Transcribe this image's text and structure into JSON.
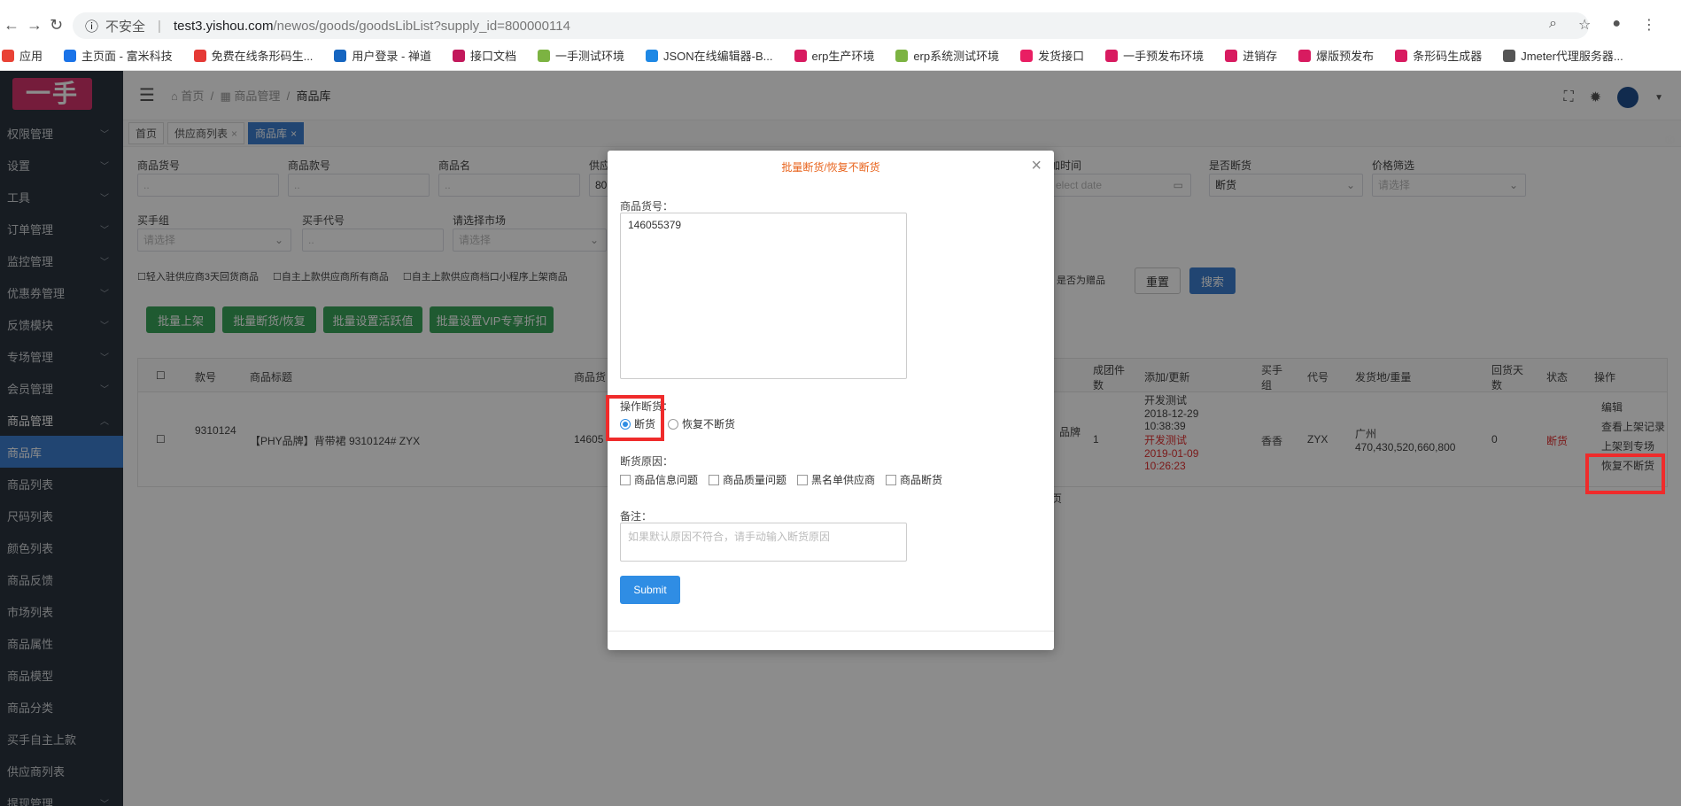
{
  "browser": {
    "insecure_label": "不安全",
    "url_host": "test3.yishou.com",
    "url_path": "/newos/goods/goodsLibList?supply_id=800000114"
  },
  "bookmarks": [
    {
      "label": "应用",
      "color": "#e94235"
    },
    {
      "label": "主页面 - 富米科技",
      "color": "#1a73e8"
    },
    {
      "label": "免费在线条形码生...",
      "color": "#e53935"
    },
    {
      "label": "用户登录 - 禅道",
      "color": "#1565c0"
    },
    {
      "label": "接口文档",
      "color": "#c2185b"
    },
    {
      "label": "一手测试环境",
      "color": "#7cb342"
    },
    {
      "label": "JSON在线编辑器-B...",
      "color": "#1e88e5"
    },
    {
      "label": "erp生产环境",
      "color": "#d81b60"
    },
    {
      "label": "erp系统测试环境",
      "color": "#7cb342"
    },
    {
      "label": "发货接口",
      "color": "#e91e63"
    },
    {
      "label": "一手预发布环境",
      "color": "#d81b60"
    },
    {
      "label": "进销存",
      "color": "#d81b60"
    },
    {
      "label": "爆版预发布",
      "color": "#d81b60"
    },
    {
      "label": "条形码生成器",
      "color": "#d81b60"
    },
    {
      "label": "Jmeter代理服务器...",
      "color": "#555555"
    }
  ],
  "sidebar": {
    "logo": "一手",
    "items": [
      {
        "label": "权限管理"
      },
      {
        "label": "设置"
      },
      {
        "label": "工具"
      },
      {
        "label": "订单管理"
      },
      {
        "label": "监控管理"
      },
      {
        "label": "优惠券管理"
      },
      {
        "label": "反馈模块"
      },
      {
        "label": "专场管理"
      },
      {
        "label": "会员管理"
      },
      {
        "label": "商品管理"
      },
      {
        "label": "商品库"
      },
      {
        "label": "商品列表"
      },
      {
        "label": "尺码列表"
      },
      {
        "label": "颜色列表"
      },
      {
        "label": "商品反馈"
      },
      {
        "label": "市场列表"
      },
      {
        "label": "商品属性"
      },
      {
        "label": "商品模型"
      },
      {
        "label": "商品分类"
      },
      {
        "label": "买手自主上款"
      },
      {
        "label": "供应商列表"
      },
      {
        "label": "提现管理"
      }
    ]
  },
  "breadcrumb": {
    "home": "首页",
    "parent": "商品管理",
    "current": "商品库"
  },
  "tabs": [
    {
      "label": "首页"
    },
    {
      "label": "供应商列表"
    },
    {
      "label": "商品库"
    }
  ],
  "filters": {
    "goods_no": "商品货号",
    "style_no": "商品款号",
    "goods_name": "商品名",
    "supplier": "供应",
    "supplier_value": "80",
    "add_time": "加时间",
    "add_time_placeholder": "elect date",
    "out_of_stock": "是否断货",
    "out_of_stock_value": "断货",
    "price_filter": "价格筛选",
    "price_placeholder": "请选择",
    "buyer_group": "买手组",
    "buyer_group_placeholder": "请选择",
    "buyer_code": "买手代号",
    "market": "请选择市场",
    "market_placeholder": "请选择",
    "check1": "轻入驻供应商3天回货商品",
    "check2": "自主上款供应商所有商品",
    "check3": "自主上款供应商档口小程序上架商品",
    "gift": "是否为赠品",
    "reset": "重置",
    "search": "搜索"
  },
  "actions": {
    "b1": "批量上架",
    "b2": "批量断货/恢复",
    "b3": "批量设置活跃值",
    "b4": "批量设置VIP专享折扣"
  },
  "table": {
    "headers": {
      "style_no": "款号",
      "title": "商品标题",
      "goods": "商品货",
      "group_count": "成团件数",
      "added": "添加/更新",
      "buyer_group": "买手组",
      "code": "代号",
      "ship": "发货地/重量",
      "days": "回货天数",
      "status": "状态",
      "op": "操作"
    },
    "row": {
      "style_no": "9310124",
      "title": "【PHY品牌】背带裙 9310124# ZYX",
      "goods": "14605",
      "brand": "品牌",
      "group_count": "1",
      "added_by": "开发测试",
      "added_at": "2018-12-29 10:38:39",
      "updated_by": "开发测试",
      "updated_at": "2019-01-09 10:26:23",
      "buyer_group": "香香",
      "code": "ZYX",
      "ship": "广州",
      "weight": "470,430,520,660,800",
      "days": "0",
      "status": "断货",
      "op_edit": "编辑",
      "op_log": "查看上架记录",
      "op_special": "上架到专场",
      "op_restore": "恢复不断货"
    },
    "page_suffix": "页"
  },
  "modal": {
    "title": "批量断货/恢复不断货",
    "goods_no_label": "商品货号：",
    "goods_no_value": "146055379",
    "op_label": "操作断货：",
    "radio_out": "断货",
    "radio_restore": "恢复不断货",
    "reason_label": "断货原因：",
    "reasons": [
      "商品信息问题",
      "商品质量问题",
      "黑名单供应商",
      "商品断货"
    ],
    "remark_label": "备注：",
    "remark_placeholder": "如果默认原因不符合，请手动输入断货原因",
    "submit": "Submit"
  }
}
